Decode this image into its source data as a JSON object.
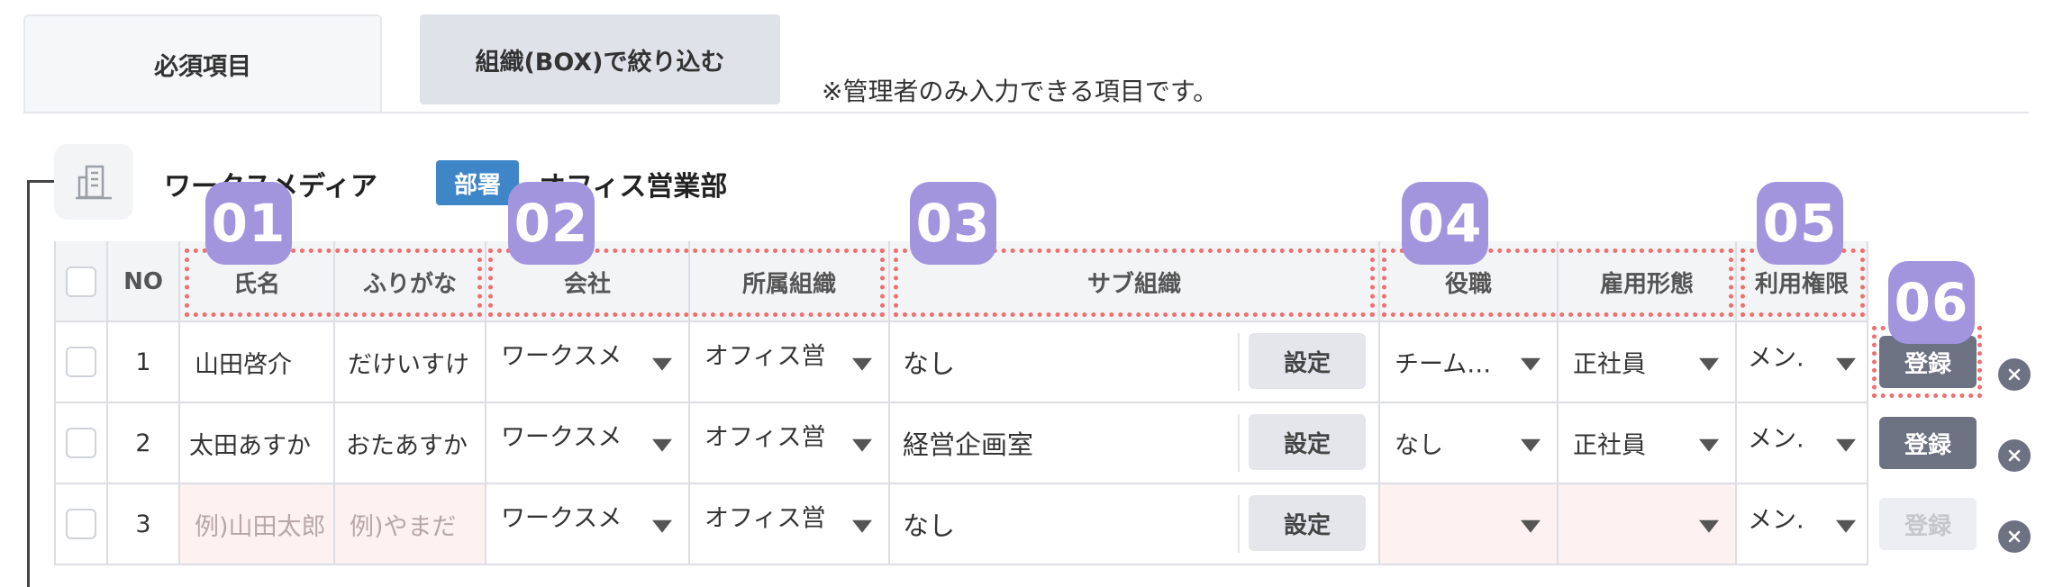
{
  "tabs": {
    "required": "必須項目",
    "org_filter": "組織(BOX)で絞り込む"
  },
  "admin_note": "※管理者のみ入力できる項目です。",
  "org": {
    "company": "ワークスメディア",
    "dept_badge": "部署",
    "dept": "オフィス営業部"
  },
  "table": {
    "headers": {
      "no": "NO",
      "name": "氏名",
      "kana": "ふりがな",
      "company": "会社",
      "org": "所属組織",
      "sub_org": "サブ組織",
      "position": "役職",
      "employment": "雇用形態",
      "permission": "利用権限"
    },
    "set_label": "設定",
    "register_label": "登録",
    "rows": [
      {
        "no": "1",
        "name": "山田啓介",
        "kana": "だけいすけ",
        "company": "ワークスメ",
        "org": "オフィス営",
        "sub_org": "なし",
        "position": "チーム…",
        "employment": "正社員",
        "permission": "メン.",
        "register_enabled": true
      },
      {
        "no": "2",
        "name": "太田あすか",
        "kana": "おたあすか",
        "company": "ワークスメ",
        "org": "オフィス営",
        "sub_org": "経営企画室",
        "position": "なし",
        "employment": "正社員",
        "permission": "メン.",
        "register_enabled": true
      },
      {
        "no": "3",
        "name": "例)山田太郎",
        "kana": "例)やまだ",
        "company": "ワークスメ",
        "org": "オフィス営",
        "sub_org": "なし",
        "position": "",
        "employment": "",
        "permission": "メン.",
        "register_enabled": false
      }
    ]
  },
  "annotations": [
    "01",
    "02",
    "03",
    "04",
    "05",
    "06"
  ],
  "colors": {
    "badge": "#a394de",
    "dashed_outline": "#ef6f6f",
    "dept_badge": "#3f86c9",
    "register_button": "#6c7282"
  }
}
